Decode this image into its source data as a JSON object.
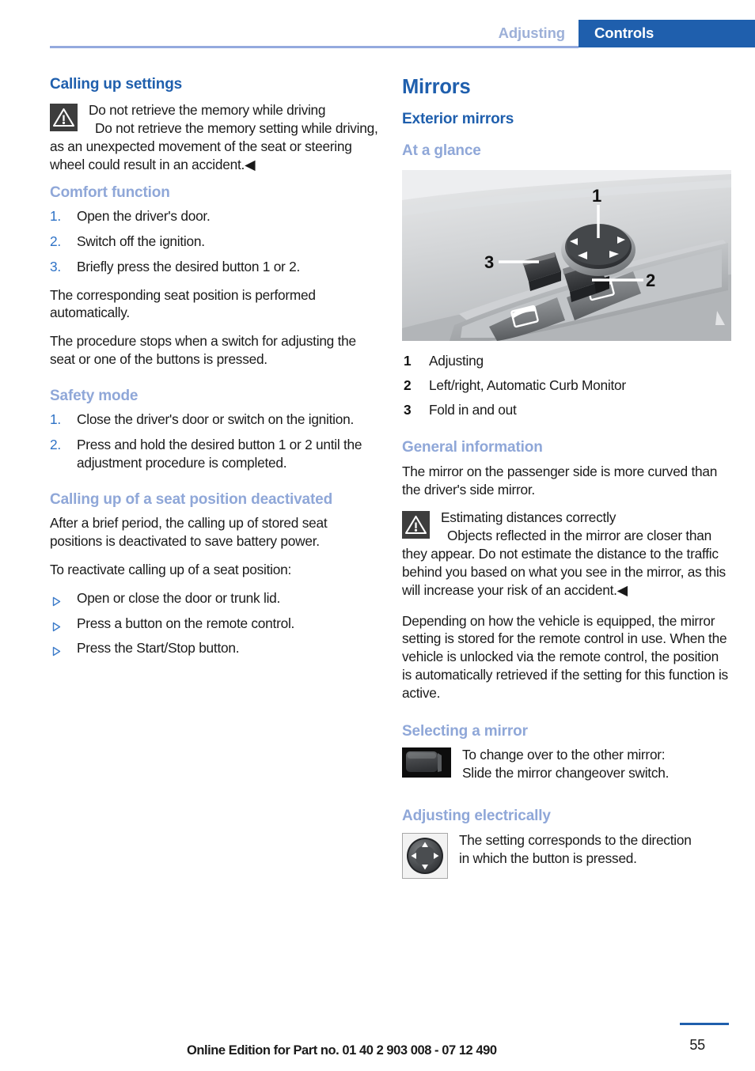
{
  "header": {
    "left_tab_label": "Adjusting",
    "right_tab_label": "Controls",
    "accent_blue": "#1f5fad",
    "muted_blue": "#9db0d8"
  },
  "left_column": {
    "heading_calling_up_settings": "Calling up settings",
    "warning_memory": {
      "icon": "warning-triangle-icon",
      "title": "Do not retrieve the memory while driving",
      "body": "Do not retrieve the memory setting while driving, as an unexpected movement of the seat or steering wheel could result in an accident.◀"
    },
    "comfort_function": {
      "heading": "Comfort function",
      "steps": [
        {
          "num": "1.",
          "text": "Open the driver's door."
        },
        {
          "num": "2.",
          "text": "Switch off the ignition."
        },
        {
          "num": "3.",
          "text": "Briefly press the desired button 1 or 2."
        }
      ],
      "paragraphs": [
        "The corresponding seat position is performed automatically.",
        "The procedure stops when a switch for adjusting the seat or one of the buttons is pressed."
      ]
    },
    "safety_mode": {
      "heading": "Safety mode",
      "steps": [
        {
          "num": "1.",
          "text": "Close the driver's door or switch on the ignition."
        },
        {
          "num": "2.",
          "text": "Press and hold the desired button 1 or 2 until the adjustment procedure is completed."
        }
      ]
    },
    "seat_position_deactivated": {
      "heading": "Calling up of a seat position deactivated",
      "paragraphs": [
        "After a brief period, the calling up of stored seat positions is deactivated to save battery power.",
        "To reactivate calling up of a seat position:"
      ],
      "bullets": [
        "Open or close the door or trunk lid.",
        "Press a button on the remote control.",
        "Press the Start/Stop button."
      ]
    }
  },
  "right_column": {
    "title": "Mirrors",
    "exterior_mirrors_heading": "Exterior mirrors",
    "at_a_glance_heading": "At a glance",
    "figure": {
      "name": "door-panel-mirror-controls-photo",
      "callouts": [
        "1",
        "2",
        "3"
      ]
    },
    "legend": [
      {
        "num": "1",
        "text": "Adjusting"
      },
      {
        "num": "2",
        "text": "Left/right, Automatic Curb Monitor"
      },
      {
        "num": "3",
        "text": "Fold in and out"
      }
    ],
    "general_information": {
      "heading": "General information",
      "intro": "The mirror on the passenger side is more curved than the driver's side mirror.",
      "warning": {
        "icon": "warning-triangle-icon",
        "title": "Estimating distances correctly",
        "body": "Objects reflected in the mirror are closer than they appear. Do not estimate the distance to the traffic behind you based on what you see in the mirror, as this will increase your risk of an accident.◀"
      },
      "closing": "Depending on how the vehicle is equipped, the mirror setting is stored for the remote control in use. When the vehicle is unlocked via the remote control, the position is automatically retrieved if the setting for this function is active."
    },
    "selecting_a_mirror": {
      "heading": "Selecting a mirror",
      "icon": "mirror-changeover-switch-icon",
      "line1": "To change over to the other mirror:",
      "line2": "Slide the mirror changeover switch."
    },
    "adjusting_electrically": {
      "heading": "Adjusting electrically",
      "icon": "four-way-joystick-icon",
      "line1": "The setting corresponds to the direction",
      "line2": "in which the button is pressed."
    }
  },
  "footer": {
    "note": "Online Edition for Part no. 01 40 2 903 008 - 07 12 490",
    "page_number": "55"
  }
}
